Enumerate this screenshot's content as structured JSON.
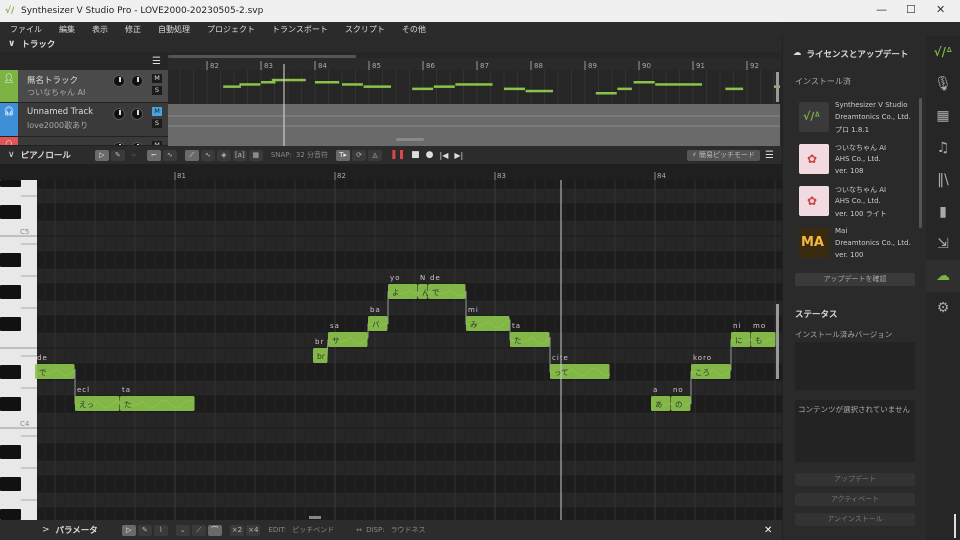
{
  "window": {
    "title": "Synthesizer V Studio Pro - LOVE2000-20230505-2.svp"
  },
  "menu": [
    "ファイル",
    "編集",
    "表示",
    "修正",
    "自動処理",
    "プロジェクト",
    "トランスポート",
    "スクリプト",
    "その他"
  ],
  "track_section": {
    "title": "トラック",
    "ruler": [
      "82",
      "83",
      "84",
      "85",
      "86",
      "87",
      "88",
      "89",
      "90",
      "91",
      "92"
    ],
    "tracks": [
      {
        "name": "無名トラック",
        "sub": "ついなちゃん AI",
        "color": "#7cb342",
        "mute": "M",
        "solo": "S",
        "mute_on": false
      },
      {
        "name": "Unnamed Track",
        "sub": "love2000歌あり",
        "color": "#3d8fd6",
        "mute": "M",
        "solo": "S",
        "mute_on": true
      },
      {
        "name": "",
        "sub": "",
        "color": "#e05555",
        "mute": "M",
        "solo": "S",
        "mute_on": false
      }
    ],
    "overview_notes": [
      [
        0.3,
        0.3,
        63
      ],
      [
        0.6,
        0.4,
        64
      ],
      [
        1.0,
        0.2,
        65
      ],
      [
        1.2,
        0.8,
        66
      ],
      [
        2.0,
        0.5,
        65
      ],
      [
        2.5,
        0.4,
        64
      ],
      [
        2.9,
        0.6,
        63
      ],
      [
        3.8,
        0.4,
        62
      ],
      [
        4.2,
        0.4,
        63
      ],
      [
        4.6,
        0.9,
        64
      ],
      [
        5.5,
        0.4,
        62
      ],
      [
        5.9,
        0.6,
        61
      ],
      [
        7.2,
        0.4,
        60
      ],
      [
        7.6,
        0.2,
        62
      ],
      [
        7.9,
        0.4,
        65
      ],
      [
        8.3,
        1.2,
        64
      ],
      [
        9.6,
        0.3,
        62
      ],
      [
        10.5,
        0.6,
        63
      ],
      [
        11.0,
        0.4,
        64
      ],
      [
        11.4,
        0.6,
        63
      ],
      [
        12.0,
        0.4,
        65
      ]
    ]
  },
  "piano_roll": {
    "title": "ピアノロール",
    "snap_label": "SNAP:",
    "snap_value": "32 分音符",
    "pitch_mode": "⚡ 簡易ピッチモード",
    "measures": [
      "81",
      "82",
      "83",
      "84"
    ],
    "key_labels": {
      "c5": "C5",
      "c4": "C4"
    },
    "notes": [
      {
        "lyric": "で",
        "phoneme": "de",
        "start": -3.5,
        "dur": 1,
        "pitch": 63
      },
      {
        "lyric": "えっ",
        "phoneme": "ecl",
        "start": -2.5,
        "dur": 1.125,
        "pitch": 61
      },
      {
        "lyric": "た",
        "phoneme": "ta",
        "start": -1.375,
        "dur": 1.875,
        "pitch": 61
      },
      {
        "lyric": "br",
        "phoneme": "br",
        "start": 3.45,
        "dur": 0.375,
        "pitch": 64
      },
      {
        "lyric": "サ",
        "phoneme": "sa",
        "start": 3.825,
        "dur": 1,
        "pitch": 65
      },
      {
        "lyric": "バ",
        "phoneme": "ba",
        "start": 4.825,
        "dur": 0.5,
        "pitch": 66
      },
      {
        "lyric": "よ",
        "phoneme": "yo",
        "start": 5.325,
        "dur": 0.75,
        "pitch": 68
      },
      {
        "lyric": "ん",
        "phoneme": "N",
        "start": 6.075,
        "dur": 0.25,
        "pitch": 68
      },
      {
        "lyric": "で",
        "phoneme": "de",
        "start": 6.325,
        "dur": 0.95,
        "pitch": 68
      },
      {
        "lyric": "み",
        "phoneme": "mi",
        "start": 7.275,
        "dur": 1.1,
        "pitch": 66
      },
      {
        "lyric": "た",
        "phoneme": "ta",
        "start": 8.375,
        "dur": 1,
        "pitch": 65
      },
      {
        "lyric": "って",
        "phoneme": "cite",
        "start": 9.375,
        "dur": 1.5,
        "pitch": 63
      },
      {
        "lyric": "あ",
        "phoneme": "a",
        "start": 11.9,
        "dur": 0.5,
        "pitch": 61
      },
      {
        "lyric": "の",
        "phoneme": "no",
        "start": 12.4,
        "dur": 0.5,
        "pitch": 61
      },
      {
        "lyric": "ころ",
        "phoneme": "koro",
        "start": 12.9,
        "dur": 1,
        "pitch": 63
      },
      {
        "lyric": "に",
        "phoneme": "ni",
        "start": 13.9,
        "dur": 0.5,
        "pitch": 65
      },
      {
        "lyric": "も",
        "phoneme": "mo",
        "start": 14.4,
        "dur": 0.625,
        "pitch": 65
      }
    ],
    "playhead_beat": 9.65
  },
  "param_bar": {
    "title": "パラメータ",
    "x2": "×2",
    "x4": "×4",
    "edit_label": "EDIT:",
    "edit_value": "ピッチベンド",
    "disp_label": "DISP:",
    "disp_value": "ラウドネス"
  },
  "right_panel": {
    "title": "ライセンスとアップデート",
    "installed": "インストール済",
    "products": [
      {
        "name": "Synthesizer V Studio",
        "vendor": "Dreamtonics Co., Ltd.",
        "version": "プロ 1.8.1"
      },
      {
        "name": "ついなちゃん AI",
        "vendor": "AHS Co., Ltd.",
        "version": "ver. 108"
      },
      {
        "name": "ついなちゃん AI",
        "vendor": "AHS Co., Ltd.",
        "version": "ver. 100 ライト"
      },
      {
        "name": "Mai",
        "vendor": "Dreamtonics Co., Ltd.",
        "version": "ver. 100"
      }
    ],
    "mai_logo": "MA",
    "check_updates": "アップデートを確認",
    "status_title": "ステータス",
    "installed_version": "インストール済みバージョン",
    "no_content": "コンテンツが選択されていません",
    "buttons": [
      "アップデート",
      "アクティベート",
      "アンインストール"
    ]
  },
  "colors": {
    "note": "#8bc34a",
    "accent": "#7cb342"
  }
}
